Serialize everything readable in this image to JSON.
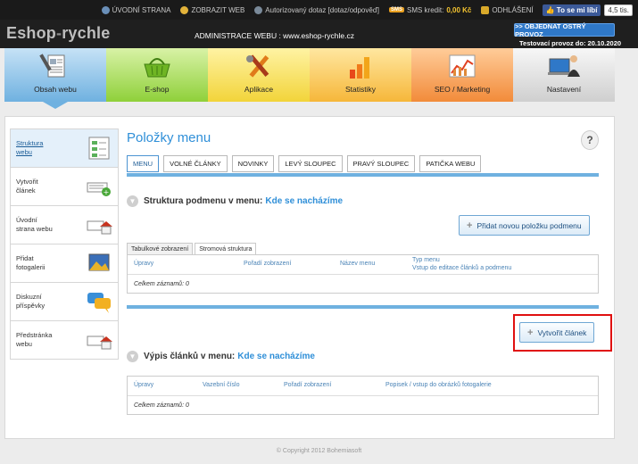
{
  "topbar": {
    "items": [
      "ÚVODNÍ STRANA",
      "ZOBRAZIT WEB",
      "Autorizovaný dotaz [dotaz/odpověď]"
    ],
    "sms_badge": "SMS",
    "sms_label": "SMS kredit:",
    "sms_value": "0,00 Kč",
    "logout": "ODHLÁŠENÍ",
    "like_label": "To se mi líbí",
    "like_count": "4,5 tis."
  },
  "header": {
    "logo_part1": "Eshop",
    "logo_dash": "-",
    "logo_part2": "rychle",
    "admin_title": "ADMINISTRACE WEBU : www.eshop-rychle.cz",
    "order_button": ">> OBJEDNAT OSTRÝ PROVOZ",
    "test_note": "Testovací provoz do: 20.10.2020"
  },
  "nav": {
    "tabs": [
      {
        "label": "Obsah webu",
        "icon": "document-icon"
      },
      {
        "label": "E-shop",
        "icon": "basket-icon"
      },
      {
        "label": "Aplikace",
        "icon": "tools-icon"
      },
      {
        "label": "Statistiky",
        "icon": "bar-chart-icon"
      },
      {
        "label": "SEO / Marketing",
        "icon": "line-chart-icon"
      },
      {
        "label": "Nastavení",
        "icon": "user-computer-icon"
      }
    ],
    "active_index": 0
  },
  "sidebar": {
    "items": [
      {
        "label": "Struktura\nwebu",
        "icon": "structure-icon"
      },
      {
        "label": "Vytvořit\nčlánek",
        "icon": "add-article-icon"
      },
      {
        "label": "Úvodní\nstrana webu",
        "icon": "home-page-icon"
      },
      {
        "label": "Přidat\nfotogalerii",
        "icon": "gallery-icon"
      },
      {
        "label": "Diskuzní\npříspěvky",
        "icon": "chat-icon"
      },
      {
        "label": "Předstránka\nwebu",
        "icon": "pre-page-icon"
      }
    ]
  },
  "main": {
    "title": "Položky menu",
    "help": "?",
    "tabs": [
      "MENU",
      "VOLNÉ ČLÁNKY",
      "NOVINKY",
      "LEVÝ SLOUPEC",
      "PRAVÝ SLOUPEC",
      "PATIČKA WEBU"
    ],
    "section1": {
      "title": "Struktura podmenu v menu:",
      "highlight": "Kde se nacházíme",
      "add_button": "Přidat novou položku podmenu",
      "subtabs": [
        "Tabulkové zobrazení",
        "Stromová struktura"
      ],
      "columns": [
        "Úpravy",
        "Pořadí zobrazení",
        "Název menu",
        "Typ menu",
        "Vstup do editace článků a podmenu"
      ],
      "total": "Celkem záznamů: 0"
    },
    "create_button": "Vytvořit článek",
    "section2": {
      "title": "Výpis článků v menu:",
      "highlight": "Kde se nacházíme",
      "columns": [
        "Úpravy",
        "Vazební číslo",
        "Pořadí zobrazení",
        "Popisek / vstup do obrázků fotogalerie"
      ],
      "total": "Celkem záznamů: 0"
    }
  },
  "footer": {
    "copyright": "© Copyright 2012 Bohemiasoft"
  },
  "colors": {
    "accent": "#2f8fd8",
    "nav_active": "#6fb1e0",
    "highlight_box": "#e01010"
  }
}
